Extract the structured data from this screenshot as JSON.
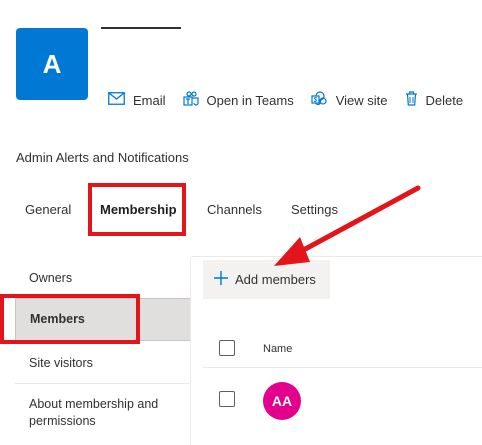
{
  "group": {
    "avatar_initial": "A",
    "title": "Admin Alerts and Notifications"
  },
  "actions": [
    {
      "label": "Email",
      "icon": "mail-icon"
    },
    {
      "label": "Open in Teams",
      "icon": "teams-icon"
    },
    {
      "label": "View site",
      "icon": "sharepoint-icon"
    },
    {
      "label": "Delete",
      "icon": "trash-icon"
    }
  ],
  "tabs": [
    {
      "label": "General",
      "selected": false
    },
    {
      "label": "Membership",
      "selected": true
    },
    {
      "label": "Channels",
      "selected": false
    },
    {
      "label": "Settings",
      "selected": false
    }
  ],
  "left_nav": [
    {
      "label": "Owners",
      "selected": false
    },
    {
      "label": "Members",
      "selected": true
    },
    {
      "label": "Site visitors",
      "selected": false
    },
    {
      "label": "About membership and permissions",
      "selected": false
    }
  ],
  "toolbar": {
    "add_members_label": "Add members"
  },
  "table": {
    "name_header": "Name",
    "rows": [
      {
        "initials": "AA",
        "avatar_color": "#e3008c"
      }
    ]
  },
  "colors": {
    "brand": "#0078d4",
    "annotation_red": "#e3151a"
  }
}
